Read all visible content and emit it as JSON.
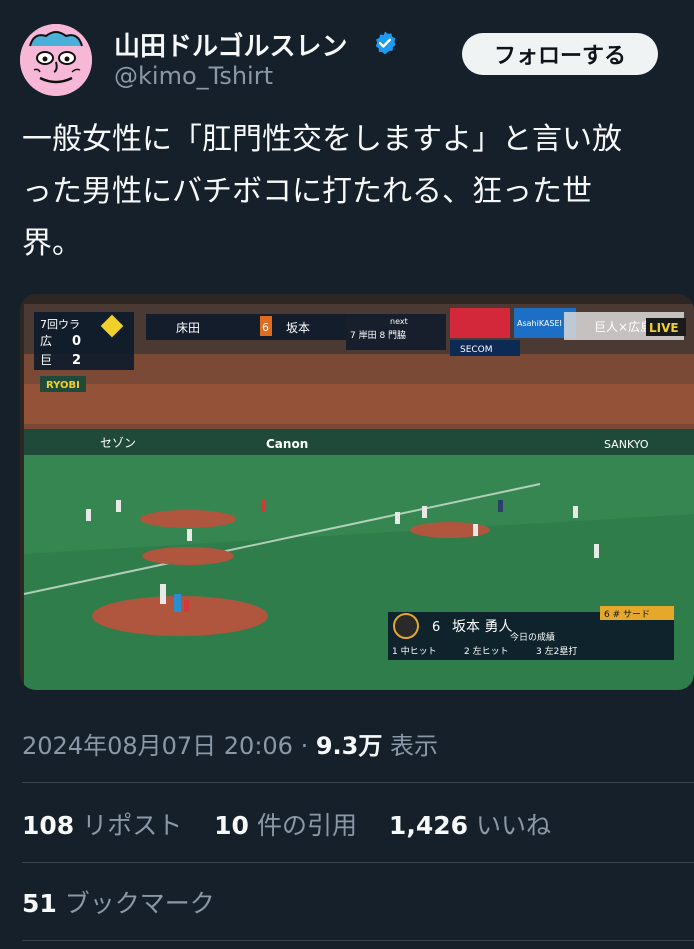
{
  "author": {
    "display_name": "山田ドルゴルスレン",
    "handle": "@kimo_Tshirt",
    "verified_icon": "verified-badge-icon",
    "avatar_color": "#f6b8d6"
  },
  "follow_button": {
    "label": "フォローする"
  },
  "tweet": {
    "text": "一般女性に「肛門性交をしますよ」と言い放\nった男性にバチボコに打たれる、狂った世\n界。"
  },
  "media": {
    "scoreboard": {
      "inning": "7回ウラ",
      "team1": "広",
      "score1": "0",
      "team2": "巨",
      "score2": "2",
      "pitcher": "床田",
      "batter": "坂本",
      "batter_number": "6",
      "live_badge": "LIVE",
      "matchup": "巨人×広島",
      "next_label": "next",
      "next_batters": "7 岸田  8 門脇"
    },
    "ads": {
      "ryobi": "RYOBI",
      "canon": "Canon",
      "sankyo": "SANKYO",
      "secom": "SECOM",
      "asahi": "AsahiKASEI",
      "saison": "セゾン"
    },
    "batter_card": {
      "number": "6",
      "name": "坂本 勇人",
      "position": "6 # サード",
      "today_label": "今日の成績",
      "at_bats": [
        "1 中ヒット",
        "2 左ヒット",
        "3 左2塁打"
      ]
    }
  },
  "meta": {
    "datetime": "2024年08月07日 20:06",
    "separator": " · ",
    "views_count": "9.3万",
    "views_label": " 表示"
  },
  "stats": {
    "reposts_count": "108",
    "reposts_label": "リポスト",
    "quotes_count": "10",
    "quotes_label": "件の引用",
    "likes_count": "1,426",
    "likes_label": "いいね"
  },
  "bookmarks": {
    "count": "51",
    "label": "ブックマーク"
  },
  "colors": {
    "background": "#15202b",
    "text": "#f7f9f9",
    "secondary": "#8b98a5",
    "verified": "#1d9bf0"
  }
}
